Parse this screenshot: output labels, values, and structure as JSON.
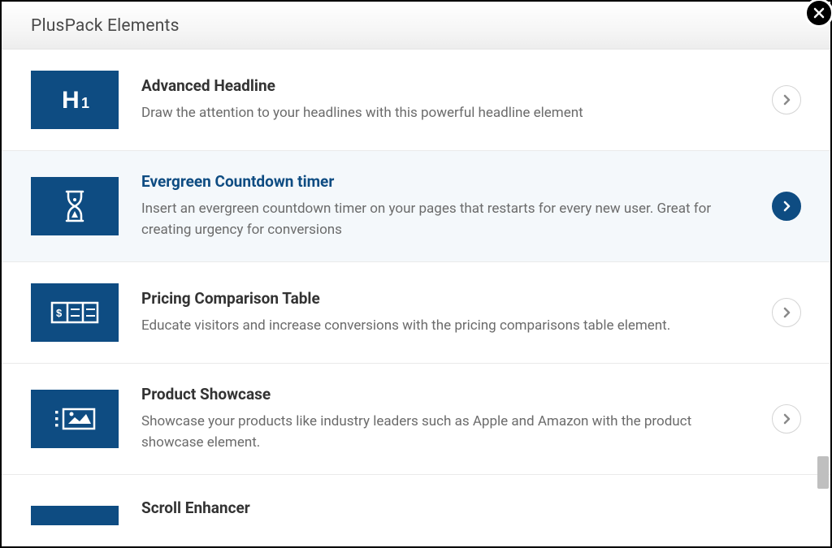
{
  "header": {
    "title": "PlusPack Elements"
  },
  "items": [
    {
      "title": "Advanced Headline",
      "description": "Draw the attention to your headlines with this powerful headline element",
      "icon": "h1-icon",
      "highlight": false
    },
    {
      "title": "Evergreen Countdown timer",
      "description": "Insert an evergreen countdown timer on your pages that restarts for every new user. Great for creating urgency for conversions",
      "icon": "hourglass-icon",
      "highlight": true
    },
    {
      "title": "Pricing Comparison Table",
      "description": "Educate visitors and increase conversions with the pricing comparisons table element.",
      "icon": "pricing-table-icon",
      "highlight": false
    },
    {
      "title": "Product Showcase",
      "description": "Showcase your products like industry leaders such as Apple and Amazon with the product showcase element.",
      "icon": "showcase-icon",
      "highlight": false
    },
    {
      "title": "Scroll Enhancer",
      "description": "",
      "icon": "scroll-icon",
      "highlight": false
    }
  ]
}
